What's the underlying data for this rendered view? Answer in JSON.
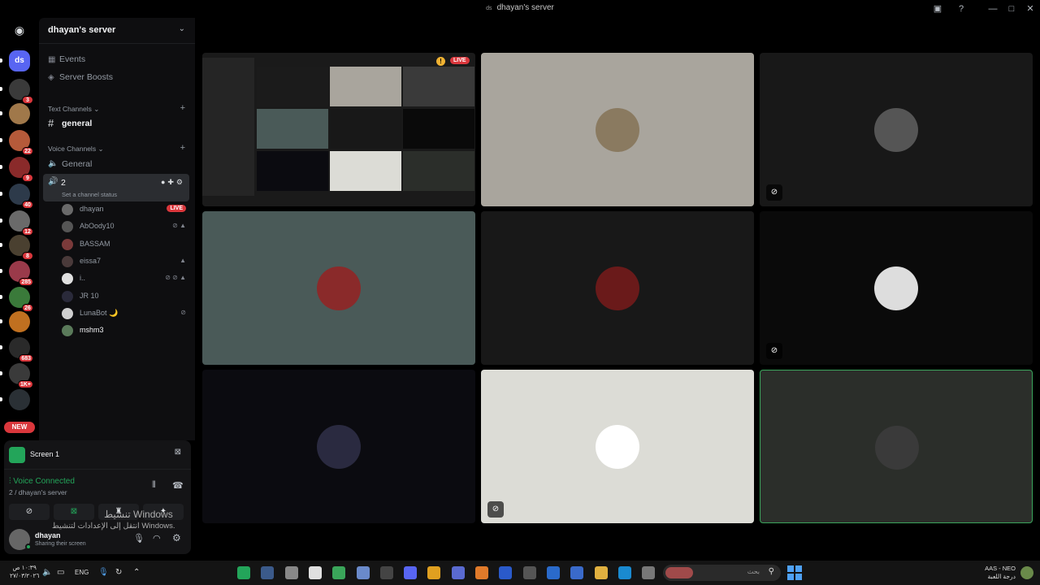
{
  "window": {
    "title": "dhayan's server",
    "title_icon": "ds"
  },
  "guilds": {
    "items": [
      {
        "label": "ds",
        "color": "#5865f2",
        "badge": ""
      },
      {
        "label": "",
        "color": "#3a3a3a",
        "badge": "3"
      },
      {
        "label": "",
        "color": "#a0784a",
        "badge": ""
      },
      {
        "label": "",
        "color": "#b55a3a",
        "badge": "22"
      },
      {
        "label": "",
        "color": "#8a2a2a",
        "badge": "9"
      },
      {
        "label": "",
        "color": "#2d3a4a",
        "badge": "40"
      },
      {
        "label": "",
        "color": "#6a6a6a",
        "badge": "12"
      },
      {
        "label": "",
        "color": "#4a4030",
        "badge": "8"
      },
      {
        "label": "",
        "color": "#9a3a4a",
        "badge": "285"
      },
      {
        "label": "",
        "color": "#3a7a3a",
        "badge": "26"
      },
      {
        "label": "",
        "color": "#c07020",
        "badge": ""
      },
      {
        "label": "",
        "color": "#2a2a2a",
        "badge": "683"
      },
      {
        "label": "",
        "color": "#3a3a3a",
        "badge": "1K+"
      },
      {
        "label": "",
        "color": "#2a3035",
        "badge": ""
      }
    ],
    "new_badge": "NEW"
  },
  "sidebar": {
    "server_name": "dhayan's server",
    "events": "Events",
    "boosts": "Server Boosts",
    "text_category": "Text Channels",
    "text_channel": "general",
    "voice_category": "Voice Channels",
    "voice_channel_general": "General",
    "active_voice_channel": "2",
    "channel_status": "Set a channel status",
    "voice_users": [
      {
        "name": "dhayan",
        "color": "#6a6a6a",
        "right": "LIVE"
      },
      {
        "name": "AbOody10",
        "color": "#555",
        "right": "⊘ ▲"
      },
      {
        "name": "BASSAM",
        "color": "#7a3a3a",
        "right": ""
      },
      {
        "name": "eissa7",
        "color": "#4a3a3a",
        "right": "▲"
      },
      {
        "name": "i..",
        "color": "#e0e0e0",
        "right": "⊘ ⊘ ▲"
      },
      {
        "name": "JR 10",
        "color": "#2a2a3a",
        "right": ""
      },
      {
        "name": "LunaBot 🌙",
        "color": "#cfcfcf",
        "right": "⊘"
      },
      {
        "name": "mshm3",
        "color": "#5a7a5a",
        "right": ""
      }
    ]
  },
  "stream_panel": {
    "label": "Screen 1"
  },
  "voice_panel": {
    "status": "Voice Connected",
    "location": "2 / dhayan's server"
  },
  "user_panel": {
    "name": "dhayan",
    "status": "Sharing their screen"
  },
  "watermark": {
    "line1": "تنشيط Windows",
    "line2": "انتقل إلى الإعدادات لتنشيط Windows."
  },
  "stream_grid": {
    "live_label": "LIVE",
    "tiles": [
      {
        "bg": "#111",
        "avatar": "",
        "is_stream": true,
        "mute": false,
        "highlight": false
      },
      {
        "bg": "#a9a59d",
        "avatar": "#8a7a60",
        "is_stream": false,
        "mute": false,
        "highlight": false
      },
      {
        "bg": "#181818",
        "avatar": "#555",
        "is_stream": false,
        "mute": true,
        "highlight": false
      },
      {
        "bg": "#4a5a58",
        "avatar": "#8a2a2a",
        "is_stream": false,
        "mute": false,
        "highlight": false
      },
      {
        "bg": "#181818",
        "avatar": "#6a1a1a",
        "is_stream": false,
        "mute": false,
        "highlight": false
      },
      {
        "bg": "#0a0a0a",
        "avatar": "#ddd",
        "is_stream": false,
        "mute": true,
        "highlight": false
      },
      {
        "bg": "#0b0b10",
        "avatar": "#2a2a40",
        "is_stream": false,
        "mute": false,
        "highlight": false
      },
      {
        "bg": "#dcdcd6",
        "avatar": "#fff",
        "is_stream": false,
        "mute": true,
        "highlight": false
      },
      {
        "bg": "#2b2e2a",
        "avatar": "#3a3a3a",
        "is_stream": false,
        "mute": false,
        "highlight": true
      }
    ]
  },
  "taskbar": {
    "time": "١٠:٣٩ ص",
    "date": "٢٧/٠٣/٢٠٢٦",
    "lang": "ENG",
    "search_placeholder": "بحث",
    "tray_label": "AAS - NEO",
    "tray_sub": "درجة اللعبة"
  }
}
